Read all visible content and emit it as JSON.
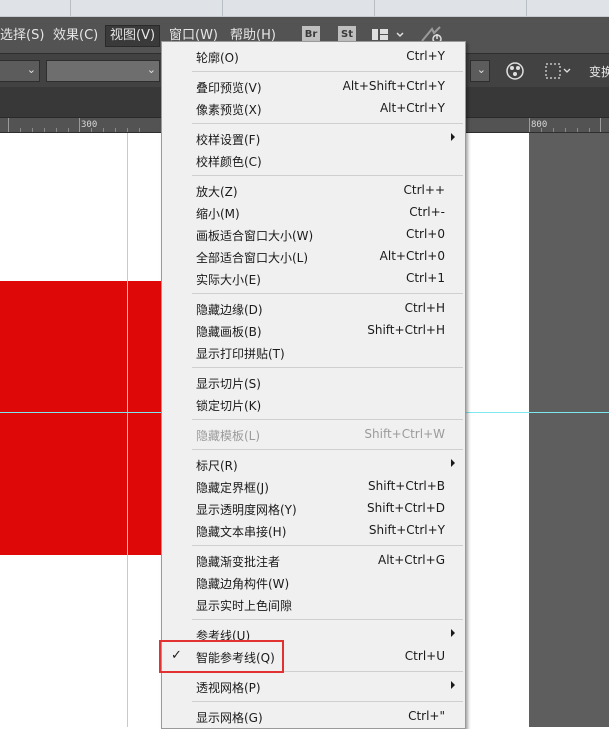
{
  "menubar": {
    "items": [
      "选择(S)",
      "效果(C)",
      "视图(V)",
      "窗口(W)",
      "帮助(H)"
    ],
    "bridge_icon": "Br",
    "stock_icon": "St",
    "right_label": "变换"
  },
  "ruler": {
    "marks": [
      "300",
      "800"
    ]
  },
  "view_menu": {
    "outline": {
      "label": "轮廓(O)",
      "shortcut": "Ctrl+Y"
    },
    "overprint_preview": {
      "label": "叠印预览(V)",
      "shortcut": "Alt+Shift+Ctrl+Y"
    },
    "pixel_preview": {
      "label": "像素预览(X)",
      "shortcut": "Alt+Ctrl+Y"
    },
    "proof_setup": {
      "label": "校样设置(F)"
    },
    "proof_colors": {
      "label": "校样颜色(C)"
    },
    "zoom_in": {
      "label": "放大(Z)",
      "shortcut": "Ctrl++"
    },
    "zoom_out": {
      "label": "缩小(M)",
      "shortcut": "Ctrl+-"
    },
    "fit_artboard": {
      "label": "画板适合窗口大小(W)",
      "shortcut": "Ctrl+0"
    },
    "fit_all": {
      "label": "全部适合窗口大小(L)",
      "shortcut": "Alt+Ctrl+0"
    },
    "actual_size": {
      "label": "实际大小(E)",
      "shortcut": "Ctrl+1"
    },
    "hide_edges": {
      "label": "隐藏边缘(D)",
      "shortcut": "Ctrl+H"
    },
    "hide_artboards": {
      "label": "隐藏画板(B)",
      "shortcut": "Shift+Ctrl+H"
    },
    "show_print_tiling": {
      "label": "显示打印拼贴(T)"
    },
    "show_slices": {
      "label": "显示切片(S)"
    },
    "lock_slices": {
      "label": "锁定切片(K)"
    },
    "hide_template": {
      "label": "隐藏模板(L)",
      "shortcut": "Shift+Ctrl+W"
    },
    "rulers": {
      "label": "标尺(R)"
    },
    "hide_bounding_box": {
      "label": "隐藏定界框(J)",
      "shortcut": "Shift+Ctrl+B"
    },
    "show_transparency_grid": {
      "label": "显示透明度网格(Y)",
      "shortcut": "Shift+Ctrl+D"
    },
    "hide_text_threads": {
      "label": "隐藏文本串接(H)",
      "shortcut": "Shift+Ctrl+Y"
    },
    "hide_gradient_annotator": {
      "label": "隐藏渐变批注者",
      "shortcut": "Alt+Ctrl+G"
    },
    "hide_corner_widget": {
      "label": "隐藏边角构件(W)"
    },
    "show_live_paint_gaps": {
      "label": "显示实时上色间隙"
    },
    "guides": {
      "label": "参考线(U)"
    },
    "smart_guides": {
      "label": "智能参考线(Q)",
      "shortcut": "Ctrl+U",
      "checkmark": "✓"
    },
    "perspective_grid": {
      "label": "透视网格(P)"
    },
    "show_grid": {
      "label": "显示网格(G)",
      "shortcut": "Ctrl+\""
    }
  },
  "colors": {
    "red_shape": "#df0808",
    "guide": "#7de8f0",
    "highlight_box": "#e23131"
  }
}
